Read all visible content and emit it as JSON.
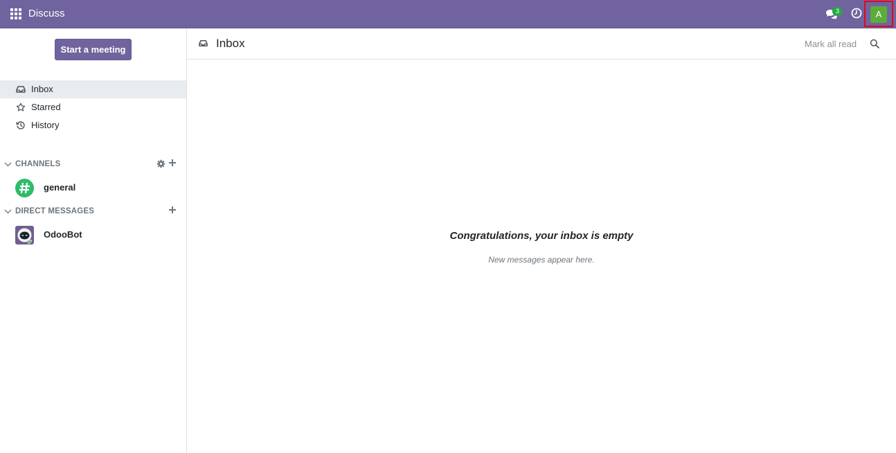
{
  "navbar": {
    "app_name": "Discuss",
    "chat_badge": "3",
    "user_initial": "A",
    "bg_color": "#71639e"
  },
  "sidebar": {
    "start_meeting_label": "Start a meeting",
    "mailboxes": [
      {
        "label": "Inbox",
        "icon": "inbox-icon",
        "active": true
      },
      {
        "label": "Starred",
        "icon": "star-icon",
        "active": false
      },
      {
        "label": "History",
        "icon": "history-icon",
        "active": false
      }
    ],
    "categories": [
      {
        "title": "CHANNELS",
        "threads": [
          {
            "label": "general",
            "icon": "hashtag-icon"
          }
        ]
      },
      {
        "title": "DIRECT MESSAGES",
        "threads": [
          {
            "label": "OdooBot",
            "icon": "odoobot-avatar"
          }
        ]
      }
    ]
  },
  "main": {
    "title": "Inbox",
    "mark_all_read": "Mark all read",
    "empty_title": "Congratulations, your inbox is empty",
    "empty_subtitle": "New messages appear here."
  }
}
